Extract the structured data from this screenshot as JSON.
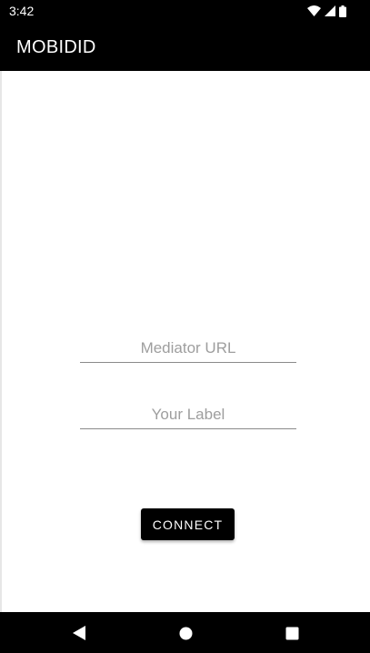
{
  "status_bar": {
    "time": "3:42",
    "icons": [
      "wifi-icon",
      "signal-icon",
      "battery-icon"
    ]
  },
  "app_bar": {
    "title": "MOBIDID"
  },
  "form": {
    "mediator_url": {
      "value": "",
      "placeholder": "Mediator URL"
    },
    "label": {
      "value": "",
      "placeholder": "Your Label"
    },
    "connect_label": "CONNECT"
  },
  "nav_bar": {
    "icons": [
      "back-icon",
      "home-icon",
      "recents-icon"
    ]
  },
  "colors": {
    "bars": "#000000",
    "background": "#ffffff",
    "button": "#000000",
    "placeholder": "#9e9e9e",
    "underline": "#8a8a8a"
  }
}
